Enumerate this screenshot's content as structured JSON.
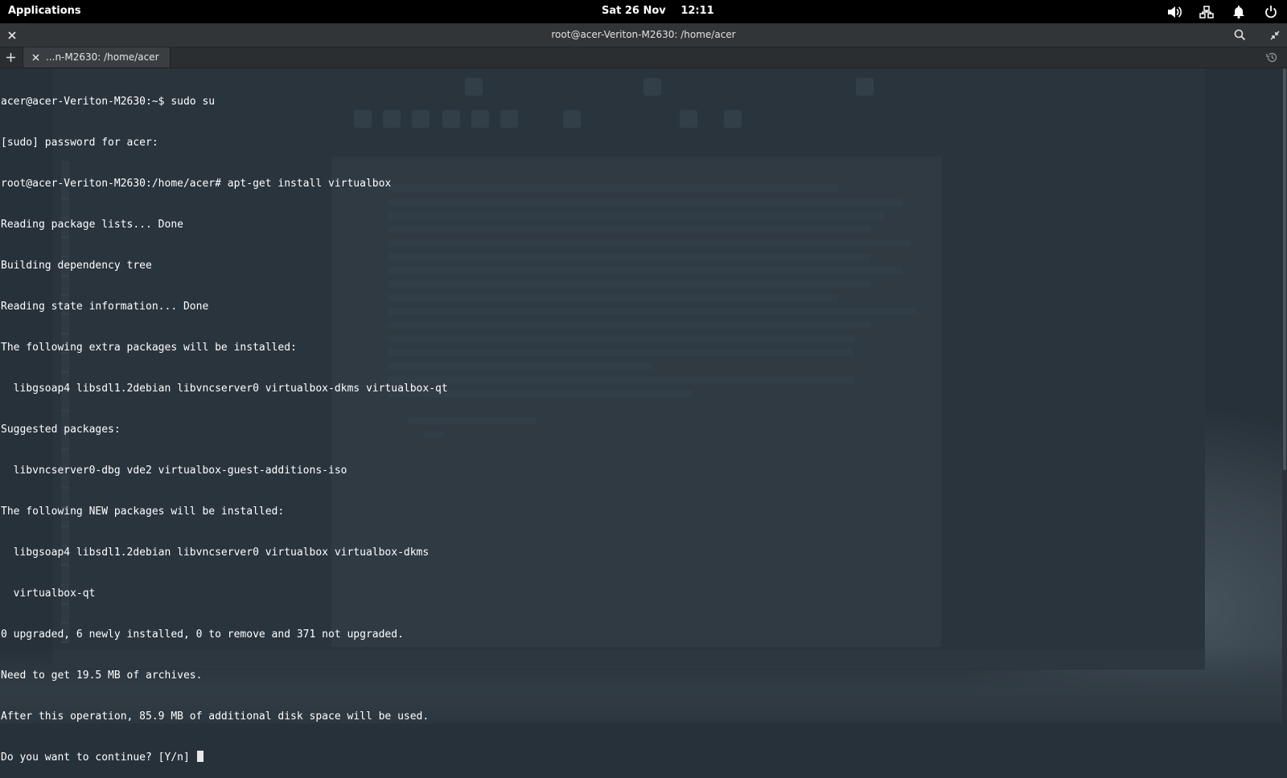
{
  "top_panel": {
    "applications_label": "Applications",
    "date": "Sat 26 Nov",
    "time": "12:11",
    "indicators": [
      "volume-icon",
      "network-icon",
      "notification-bell-icon",
      "power-icon"
    ]
  },
  "window": {
    "title": "root@acer-Veriton-M2630: /home/acer",
    "close_icon": "close-icon",
    "search_icon": "search-icon",
    "unmaximize_icon": "unmaximize-icon"
  },
  "tabs": {
    "new_tab_icon": "plus-icon",
    "items": [
      {
        "label": "...n-M2630: /home/acer"
      }
    ],
    "history_icon": "history-icon"
  },
  "terminal": {
    "lines": [
      "acer@acer-Veriton-M2630:~$ sudo su",
      "[sudo] password for acer:",
      "root@acer-Veriton-M2630:/home/acer# apt-get install virtualbox",
      "Reading package lists... Done",
      "Building dependency tree",
      "Reading state information... Done",
      "The following extra packages will be installed:",
      "  libgsoap4 libsdl1.2debian libvncserver0 virtualbox-dkms virtualbox-qt",
      "Suggested packages:",
      "  libvncserver0-dbg vde2 virtualbox-guest-additions-iso",
      "The following NEW packages will be installed:",
      "  libgsoap4 libsdl1.2debian libvncserver0 virtualbox virtualbox-dkms",
      "  virtualbox-qt",
      "0 upgraded, 6 newly installed, 0 to remove and 371 not upgraded.",
      "Need to get 19.5 MB of archives.",
      "After this operation, 85.9 MB of additional disk space will be used.",
      "Do you want to continue? [Y/n] "
    ]
  },
  "colors": {
    "panel_bg": "#000000",
    "titlebar_bg": "#323538",
    "terminal_bg": "#27313a",
    "terminal_fg": "#ffffff"
  }
}
